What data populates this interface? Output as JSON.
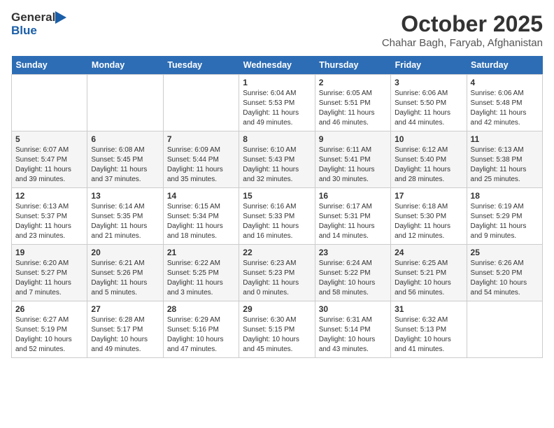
{
  "header": {
    "logo_general": "General",
    "logo_blue": "Blue",
    "month": "October 2025",
    "location": "Chahar Bagh, Faryab, Afghanistan"
  },
  "weekdays": [
    "Sunday",
    "Monday",
    "Tuesday",
    "Wednesday",
    "Thursday",
    "Friday",
    "Saturday"
  ],
  "weeks": [
    [
      {
        "day": "",
        "info": ""
      },
      {
        "day": "",
        "info": ""
      },
      {
        "day": "",
        "info": ""
      },
      {
        "day": "1",
        "info": "Sunrise: 6:04 AM\nSunset: 5:53 PM\nDaylight: 11 hours\nand 49 minutes."
      },
      {
        "day": "2",
        "info": "Sunrise: 6:05 AM\nSunset: 5:51 PM\nDaylight: 11 hours\nand 46 minutes."
      },
      {
        "day": "3",
        "info": "Sunrise: 6:06 AM\nSunset: 5:50 PM\nDaylight: 11 hours\nand 44 minutes."
      },
      {
        "day": "4",
        "info": "Sunrise: 6:06 AM\nSunset: 5:48 PM\nDaylight: 11 hours\nand 42 minutes."
      }
    ],
    [
      {
        "day": "5",
        "info": "Sunrise: 6:07 AM\nSunset: 5:47 PM\nDaylight: 11 hours\nand 39 minutes."
      },
      {
        "day": "6",
        "info": "Sunrise: 6:08 AM\nSunset: 5:45 PM\nDaylight: 11 hours\nand 37 minutes."
      },
      {
        "day": "7",
        "info": "Sunrise: 6:09 AM\nSunset: 5:44 PM\nDaylight: 11 hours\nand 35 minutes."
      },
      {
        "day": "8",
        "info": "Sunrise: 6:10 AM\nSunset: 5:43 PM\nDaylight: 11 hours\nand 32 minutes."
      },
      {
        "day": "9",
        "info": "Sunrise: 6:11 AM\nSunset: 5:41 PM\nDaylight: 11 hours\nand 30 minutes."
      },
      {
        "day": "10",
        "info": "Sunrise: 6:12 AM\nSunset: 5:40 PM\nDaylight: 11 hours\nand 28 minutes."
      },
      {
        "day": "11",
        "info": "Sunrise: 6:13 AM\nSunset: 5:38 PM\nDaylight: 11 hours\nand 25 minutes."
      }
    ],
    [
      {
        "day": "12",
        "info": "Sunrise: 6:13 AM\nSunset: 5:37 PM\nDaylight: 11 hours\nand 23 minutes."
      },
      {
        "day": "13",
        "info": "Sunrise: 6:14 AM\nSunset: 5:35 PM\nDaylight: 11 hours\nand 21 minutes."
      },
      {
        "day": "14",
        "info": "Sunrise: 6:15 AM\nSunset: 5:34 PM\nDaylight: 11 hours\nand 18 minutes."
      },
      {
        "day": "15",
        "info": "Sunrise: 6:16 AM\nSunset: 5:33 PM\nDaylight: 11 hours\nand 16 minutes."
      },
      {
        "day": "16",
        "info": "Sunrise: 6:17 AM\nSunset: 5:31 PM\nDaylight: 11 hours\nand 14 minutes."
      },
      {
        "day": "17",
        "info": "Sunrise: 6:18 AM\nSunset: 5:30 PM\nDaylight: 11 hours\nand 12 minutes."
      },
      {
        "day": "18",
        "info": "Sunrise: 6:19 AM\nSunset: 5:29 PM\nDaylight: 11 hours\nand 9 minutes."
      }
    ],
    [
      {
        "day": "19",
        "info": "Sunrise: 6:20 AM\nSunset: 5:27 PM\nDaylight: 11 hours\nand 7 minutes."
      },
      {
        "day": "20",
        "info": "Sunrise: 6:21 AM\nSunset: 5:26 PM\nDaylight: 11 hours\nand 5 minutes."
      },
      {
        "day": "21",
        "info": "Sunrise: 6:22 AM\nSunset: 5:25 PM\nDaylight: 11 hours\nand 3 minutes."
      },
      {
        "day": "22",
        "info": "Sunrise: 6:23 AM\nSunset: 5:23 PM\nDaylight: 11 hours\nand 0 minutes."
      },
      {
        "day": "23",
        "info": "Sunrise: 6:24 AM\nSunset: 5:22 PM\nDaylight: 10 hours\nand 58 minutes."
      },
      {
        "day": "24",
        "info": "Sunrise: 6:25 AM\nSunset: 5:21 PM\nDaylight: 10 hours\nand 56 minutes."
      },
      {
        "day": "25",
        "info": "Sunrise: 6:26 AM\nSunset: 5:20 PM\nDaylight: 10 hours\nand 54 minutes."
      }
    ],
    [
      {
        "day": "26",
        "info": "Sunrise: 6:27 AM\nSunset: 5:19 PM\nDaylight: 10 hours\nand 52 minutes."
      },
      {
        "day": "27",
        "info": "Sunrise: 6:28 AM\nSunset: 5:17 PM\nDaylight: 10 hours\nand 49 minutes."
      },
      {
        "day": "28",
        "info": "Sunrise: 6:29 AM\nSunset: 5:16 PM\nDaylight: 10 hours\nand 47 minutes."
      },
      {
        "day": "29",
        "info": "Sunrise: 6:30 AM\nSunset: 5:15 PM\nDaylight: 10 hours\nand 45 minutes."
      },
      {
        "day": "30",
        "info": "Sunrise: 6:31 AM\nSunset: 5:14 PM\nDaylight: 10 hours\nand 43 minutes."
      },
      {
        "day": "31",
        "info": "Sunrise: 6:32 AM\nSunset: 5:13 PM\nDaylight: 10 hours\nand 41 minutes."
      },
      {
        "day": "",
        "info": ""
      }
    ]
  ]
}
